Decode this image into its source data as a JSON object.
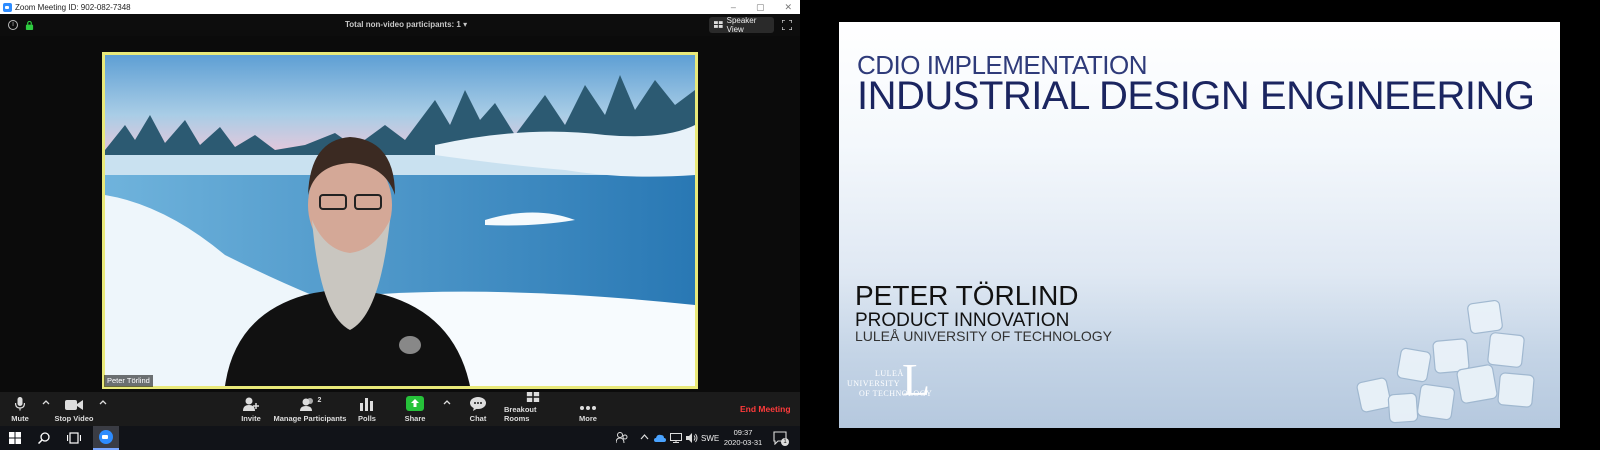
{
  "zoom": {
    "title": "Zoom Meeting ID: 902-082-7348",
    "window_controls": [
      "–",
      "▢",
      "✕"
    ],
    "top_bar": {
      "non_video_participants": "Total non-video participants: 1 ▾",
      "view_button": "Speaker View"
    },
    "video": {
      "participant_name": "Peter Törlind"
    },
    "toolbar": {
      "mute": "Mute",
      "stop_video": "Stop Video",
      "invite": "Invite",
      "manage_participants": "Manage Participants",
      "participant_count": "2",
      "polls": "Polls",
      "share": "Share",
      "chat": "Chat",
      "breakout_rooms": "Breakout Rooms",
      "more": "More",
      "end_meeting": "End Meeting"
    },
    "colors": {
      "end_meeting": "#ff3b3b",
      "share": "#26c23a",
      "speaker_border": "#e9e97a"
    }
  },
  "taskbar": {
    "language": "SWE",
    "time": "09:37",
    "date": "2020-03-31",
    "notification_count": "1"
  },
  "slide": {
    "subtitle": "CDIO IMPLEMENTATION",
    "title": "INDUSTRIAL DESIGN ENGINEERING",
    "presenter": "PETER TÖRLIND",
    "department": "PRODUCT INNOVATION",
    "university": "LULEÅ UNIVERSITY OF TECHNOLOGY",
    "logo": {
      "line1": "LULEÅ",
      "line2": "UNIVERSITY",
      "line3": "OF TECHNOLOGY",
      "letter": "L"
    }
  }
}
